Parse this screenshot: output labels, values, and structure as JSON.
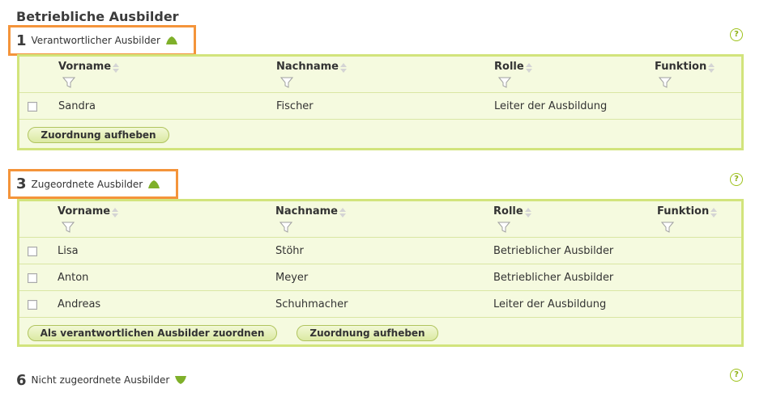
{
  "page_title": "Betriebliche Ausbilder",
  "help_symbol": "?",
  "sections": [
    {
      "number": "1",
      "label": "Verantwortlicher Ausbilder",
      "toggle": "collapse-arrow-up",
      "columns": [
        "Vorname",
        "Nachname",
        "Rolle",
        "Funktion"
      ],
      "rows": [
        {
          "vorname": "Sandra",
          "nachname": "Fischer",
          "rolle": "Leiter der Ausbildung",
          "funktion": ""
        }
      ],
      "actions": [
        "Zuordnung aufheben"
      ]
    },
    {
      "number": "3",
      "label": "Zugeordnete Ausbilder",
      "toggle": "collapse-arrow-up",
      "columns": [
        "Vorname",
        "Nachname",
        "Rolle",
        "Funktion"
      ],
      "rows": [
        {
          "vorname": "Lisa",
          "nachname": "Stöhr",
          "rolle": "Betrieblicher Ausbilder",
          "funktion": ""
        },
        {
          "vorname": "Anton",
          "nachname": "Meyer",
          "rolle": "Betrieblicher Ausbilder",
          "funktion": ""
        },
        {
          "vorname": "Andreas",
          "nachname": "Schuhmacher",
          "rolle": "Leiter der Ausbildung",
          "funktion": ""
        }
      ],
      "actions": [
        "Als verantwortlichen Ausbilder zuordnen",
        "Zuordnung aufheben"
      ]
    },
    {
      "number": "6",
      "label": "Nicht zugeordnete Ausbilder",
      "toggle": "expand-arrow-down"
    }
  ],
  "colors": {
    "accent_green": "#7fb02a",
    "table_border": "#d2e47c",
    "table_bg": "#f5fadf",
    "highlight_border": "#f4943a"
  }
}
